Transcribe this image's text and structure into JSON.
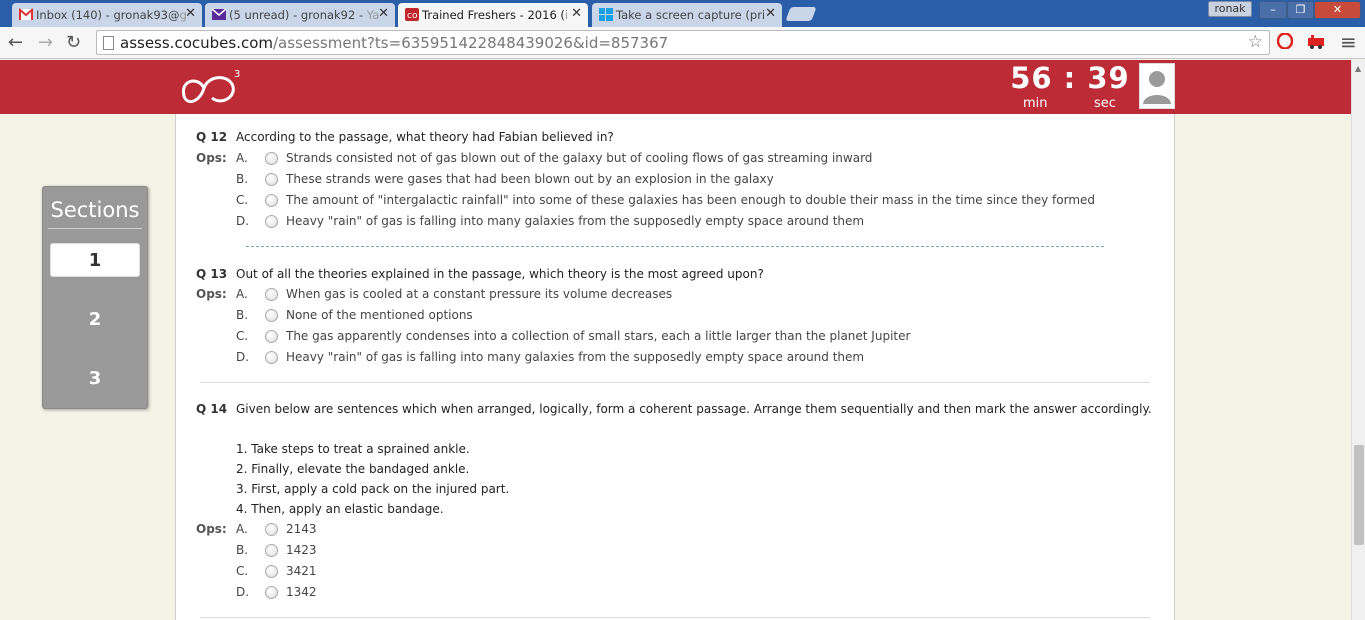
{
  "browser": {
    "tabs": [
      {
        "label": "Inbox (140) - gronak93@",
        "fade": "g",
        "icon": "gmail-icon"
      },
      {
        "label": "(5 unread) - gronak92 - ",
        "fade": "Ya",
        "icon": "yahoo-mail-icon"
      },
      {
        "label": "Trained Freshers - 2016 (",
        "fade": "i",
        "icon": "cocubes-icon"
      },
      {
        "label": "Take a screen capture (pri",
        "fade": "",
        "icon": "windows-icon"
      }
    ],
    "tab_close": "✕",
    "profile_name": "ronak",
    "url_host": "assess.cocubes.com",
    "url_path": "/assessment?ts=635951422848439026&id=857367",
    "back": "←",
    "forward": "→",
    "reload": "↻",
    "star": "☆",
    "menu": "≡"
  },
  "header": {
    "logo_sup": "3",
    "timer_value": "56 : 39",
    "timer_min": "min",
    "timer_sec": "sec"
  },
  "sections": {
    "title": "Sections",
    "items": [
      "1",
      "2",
      "3"
    ]
  },
  "ops_label": "Ops:",
  "questions": [
    {
      "num": "Q 12",
      "text": "According to the passage, what theory had Fabian believed in?",
      "options": [
        {
          "letter": "A.",
          "text": "Strands consisted not of gas blown out of the galaxy but of cooling flows of gas streaming inward"
        },
        {
          "letter": "B.",
          "text": "These strands were gases that had been blown out by an explosion in the galaxy"
        },
        {
          "letter": "C.",
          "text": "The amount of \"intergalactic rainfall\" into some of these galaxies has been enough to double their mass in the time since they formed"
        },
        {
          "letter": "D.",
          "text": "Heavy \"rain\" of gas is falling into many galaxies from the supposedly empty space around them"
        }
      ]
    },
    {
      "num": "Q 13",
      "text": "Out of all the theories explained in the passage, which theory is the most agreed upon?",
      "options": [
        {
          "letter": "A.",
          "text": "When gas is cooled at a constant pressure its volume decreases"
        },
        {
          "letter": "B.",
          "text": "None of the mentioned options"
        },
        {
          "letter": "C.",
          "text": "The gas apparently condenses into a collection of small stars, each a little larger than the planet Jupiter"
        },
        {
          "letter": "D.",
          "text": "Heavy \"rain\" of gas is falling into many galaxies from the supposedly empty space around them"
        }
      ]
    },
    {
      "num": "Q 14",
      "text": "Given below are sentences which when arranged, logically, form a coherent passage. Arrange them sequentially and then mark the answer accordingly.",
      "sentences": [
        "1. Take steps to treat a sprained ankle.",
        "2. Finally, elevate the bandaged ankle.",
        "3. First, apply a cold pack on the injured part.",
        "4. Then, apply an elastic bandage."
      ],
      "options": [
        {
          "letter": "A.",
          "text": "2143"
        },
        {
          "letter": "B.",
          "text": "1423"
        },
        {
          "letter": "C.",
          "text": "3421"
        },
        {
          "letter": "D.",
          "text": "1342"
        }
      ]
    }
  ]
}
